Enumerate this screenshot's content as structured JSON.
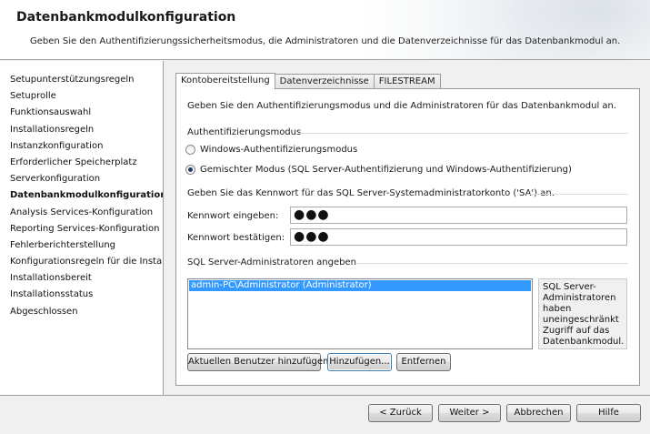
{
  "header": {
    "title": "Datenbankmodulkonfiguration",
    "subtitle": "Geben Sie den Authentifizierungssicherheitsmodus, die Administratoren und die Datenverzeichnisse für das Datenbankmodul an."
  },
  "sidebar": {
    "items": [
      {
        "label": "Setupunterstützungsregeln"
      },
      {
        "label": "Setuprolle"
      },
      {
        "label": "Funktionsauswahl"
      },
      {
        "label": "Installationsregeln"
      },
      {
        "label": "Instanzkonfiguration"
      },
      {
        "label": "Erforderlicher Speicherplatz"
      },
      {
        "label": "Serverkonfiguration"
      },
      {
        "label": "Datenbankmodulkonfiguration"
      },
      {
        "label": "Analysis Services-Konfiguration"
      },
      {
        "label": "Reporting Services-Konfiguration"
      },
      {
        "label": "Fehlerberichterstellung"
      },
      {
        "label": "Konfigurationsregeln für die Install..."
      },
      {
        "label": "Installationsbereit"
      },
      {
        "label": "Installationsstatus"
      },
      {
        "label": "Abgeschlossen"
      }
    ],
    "active_index": 7
  },
  "tabs": [
    {
      "label": "Kontobereitstellung",
      "active": true
    },
    {
      "label": "Datenverzeichnisse",
      "active": false
    },
    {
      "label": "FILESTREAM",
      "active": false
    }
  ],
  "panel": {
    "intro": "Geben Sie den Authentifizierungsmodus und die Administratoren für das Datenbankmodul an.",
    "auth_group_title": "Authentifizierungsmodus",
    "radio_windows": "Windows-Authentifizierungsmodus",
    "radio_mixed": "Gemischter Modus (SQL Server-Authentifizierung und Windows-Authentifizierung)",
    "selected_mode": "mixed",
    "password_group_title": "Geben Sie das Kennwort für das SQL Server-Systemadministratorkonto ('SA') an.",
    "password_label": "Kennwort eingeben:",
    "password_value": "●●●",
    "confirm_label": "Kennwort bestätigen:",
    "confirm_value": "●●●",
    "admins_group_title": "SQL Server-Administratoren angeben",
    "admins": [
      "admin-PC\\Administrator (Administrator)"
    ],
    "admins_info": "SQL Server-Administratoren haben uneingeschränkt Zugriff auf das Datenbankmodul.",
    "btn_add_current": "Aktuellen Benutzer hinzufügen",
    "btn_add": "Hinzufügen...",
    "btn_remove": "Entfernen"
  },
  "footer": {
    "back": "< Zurück",
    "next": "Weiter >",
    "cancel": "Abbrechen",
    "help": "Hilfe"
  }
}
